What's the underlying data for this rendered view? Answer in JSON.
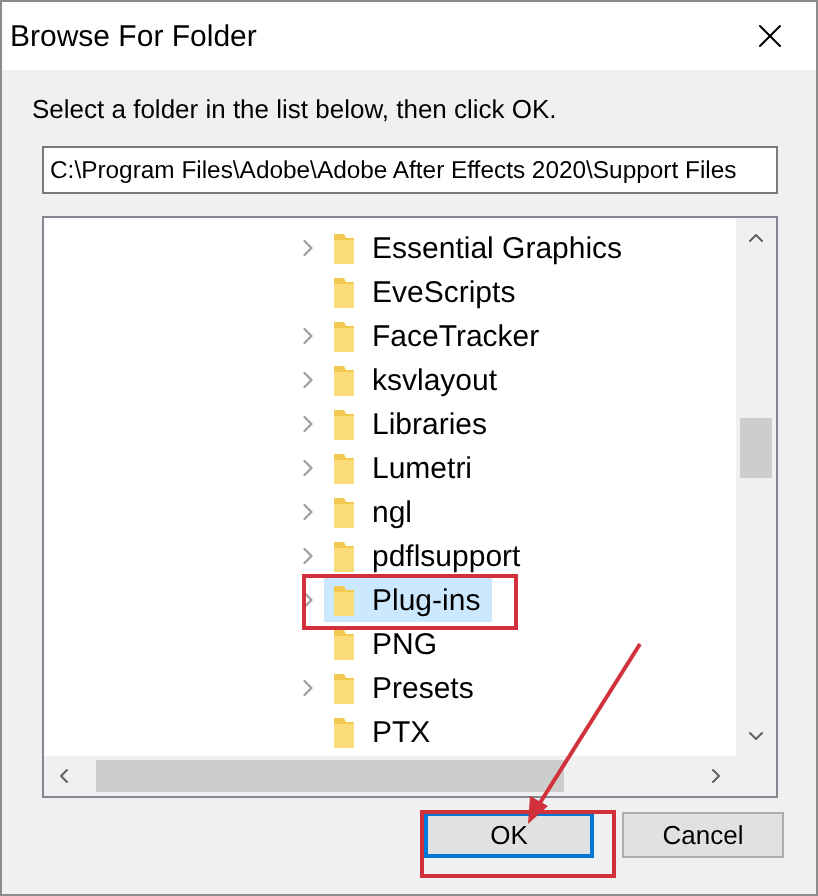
{
  "window": {
    "title": "Browse For Folder"
  },
  "instruction": "Select a folder in the list below, then click OK.",
  "path": {
    "value": "C:\\Program Files\\Adobe\\Adobe After Effects 2020\\Support Files"
  },
  "tree": {
    "items": [
      {
        "label": "Essential Graphics",
        "has_children": true,
        "selected": false
      },
      {
        "label": "EveScripts",
        "has_children": false,
        "selected": false
      },
      {
        "label": "FaceTracker",
        "has_children": true,
        "selected": false
      },
      {
        "label": "ksvlayout",
        "has_children": true,
        "selected": false
      },
      {
        "label": "Libraries",
        "has_children": true,
        "selected": false
      },
      {
        "label": "Lumetri",
        "has_children": true,
        "selected": false
      },
      {
        "label": "ngl",
        "has_children": true,
        "selected": false
      },
      {
        "label": "pdflsupport",
        "has_children": true,
        "selected": false
      },
      {
        "label": "Plug-ins",
        "has_children": true,
        "selected": true
      },
      {
        "label": "PNG",
        "has_children": false,
        "selected": false
      },
      {
        "label": "Presets",
        "has_children": true,
        "selected": false
      },
      {
        "label": "PTX",
        "has_children": false,
        "selected": false
      }
    ]
  },
  "buttons": [
    {
      "label": "OK",
      "default": true
    },
    {
      "label": "Cancel",
      "default": false
    }
  ]
}
